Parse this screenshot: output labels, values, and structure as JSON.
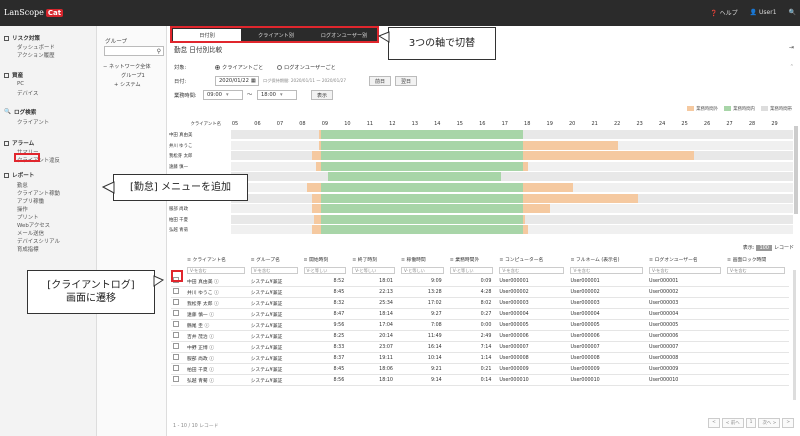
{
  "app": {
    "logo_text": "LanScope",
    "logo_badge": "Cat"
  },
  "top_tabs": [
    {
      "label": "日付別"
    },
    {
      "label": "クライアント別"
    },
    {
      "label": "ログオンユーザー別"
    }
  ],
  "top_right": {
    "help": "ヘルプ",
    "user": "User1"
  },
  "nav": {
    "sections": [
      {
        "title": "リスク対策",
        "items": [
          "ダッシュボード",
          "アクション履歴"
        ]
      },
      {
        "title": "資産",
        "items": [
          "PC",
          "デバイス"
        ]
      },
      {
        "title": "ログ検索",
        "items": [
          "クライアント"
        ]
      },
      {
        "title": "アラーム",
        "items": [
          "サマリー",
          "クライアント違反"
        ]
      },
      {
        "title": "レポート",
        "items": [
          "勤怠",
          "クライアント稼動",
          "アプリ稼働",
          "操作",
          "プリント",
          "Webアクセス",
          "メール送信",
          "デバイスシリアル",
          "育成指標"
        ]
      }
    ]
  },
  "group_panel": {
    "title": "グループ",
    "tree": [
      "ネットワーク全体",
      "グループ1",
      "システム"
    ]
  },
  "page": {
    "title": "勤怠 日付別比較"
  },
  "filters": {
    "target_label": "対象:",
    "radio_client": "クライアントごと",
    "radio_user": "ログオンユーザーごと",
    "date_label": "日付:",
    "date_value": "2020/01/22",
    "date_note": "ログ保持期間: 2020/01/11 ～ 2020/01/27",
    "prev_button": "前日",
    "next_button": "翌日",
    "hours_label": "業務時間:",
    "hours_from": "09:00",
    "hours_to": "18:00",
    "tilde": "～",
    "show_button": "表示"
  },
  "legend": [
    {
      "label": "業務時間外",
      "color": "#f5c9a0"
    },
    {
      "label": "業務時間内",
      "color": "#a8d5a8"
    },
    {
      "label": "業務時間帯",
      "color": "#dddddd"
    }
  ],
  "chart_data": {
    "type": "timeline",
    "row_header": "クライアント名",
    "hours": [
      "05",
      "06",
      "07",
      "08",
      "09",
      "10",
      "11",
      "12",
      "13",
      "14",
      "15",
      "16",
      "17",
      "18",
      "19",
      "20",
      "21",
      "22",
      "23",
      "24",
      "25",
      "26",
      "27",
      "28",
      "29"
    ],
    "business_hours": [
      9,
      18
    ],
    "rows": [
      {
        "name": "中田 真由美",
        "start": 8.9,
        "end": 18.0
      },
      {
        "name": "井川 ゆうこ",
        "start": 8.9,
        "end": 22.2
      },
      {
        "name": "我松芽 太郎",
        "start": 8.6,
        "end": 25.6
      },
      {
        "name": "遠藤 慎一",
        "start": 8.8,
        "end": 18.2
      },
      {
        "name": "",
        "start": 9.3,
        "end": 17.0
      },
      {
        "name": "",
        "start": 8.4,
        "end": 20.2
      },
      {
        "name": "",
        "start": 8.6,
        "end": 23.1
      },
      {
        "name": "服部 尚政",
        "start": 8.6,
        "end": 19.2
      },
      {
        "name": "柏田 千夏",
        "start": 8.7,
        "end": 18.1
      },
      {
        "name": "弘越 青菊",
        "start": 8.6,
        "end": 18.2
      }
    ]
  },
  "table": {
    "display_count_label": "表示:",
    "display_count": "100",
    "display_count_suffix": "レコード",
    "columns": [
      "クライアント名",
      "グループ名",
      "開始時刻",
      "終了時刻",
      "稼働時間",
      "業務時間外",
      "コンピューター名",
      "フルネーム (表示名)",
      "ログオンユーザー名",
      "画面ロック時間"
    ],
    "filter_contains": "V-を含む",
    "filter_equals": "V-と等しい",
    "rows": [
      {
        "client": "中田 真由美 ⓘ",
        "group": "システム¥兼証",
        "start": "8:52",
        "end": "18:01",
        "work": "9:09",
        "over": "0:09",
        "computer": "User000001",
        "fullname": "User000001",
        "logon": "User000001"
      },
      {
        "client": "井川 ゆうこ ⓘ",
        "group": "システム¥兼証",
        "start": "8:45",
        "end": "22:13",
        "work": "13:28",
        "over": "4:28",
        "computer": "User000002",
        "fullname": "User000002",
        "logon": "User000002"
      },
      {
        "client": "我松芽 太郎 ⓘ",
        "group": "システム¥兼証",
        "start": "8:32",
        "end": "25:34",
        "work": "17:02",
        "over": "8:02",
        "computer": "User000003",
        "fullname": "User000003",
        "logon": "User000003"
      },
      {
        "client": "遠藤 慎一 ⓘ",
        "group": "システム¥兼証",
        "start": "8:47",
        "end": "18:14",
        "work": "9:27",
        "over": "0:27",
        "computer": "User000004",
        "fullname": "User000004",
        "logon": "User000004"
      },
      {
        "client": "鶴尾 圭 ⓘ",
        "group": "システム¥兼証",
        "start": "9:56",
        "end": "17:04",
        "work": "7:08",
        "over": "0:00",
        "computer": "User000005",
        "fullname": "User000005",
        "logon": "User000005"
      },
      {
        "client": "吉井 茂治 ⓘ",
        "group": "システム¥兼証",
        "start": "8:25",
        "end": "20:14",
        "work": "11:49",
        "over": "2:49",
        "computer": "User000006",
        "fullname": "User000006",
        "logon": "User000006"
      },
      {
        "client": "中野 正博 ⓘ",
        "group": "システム¥兼証",
        "start": "8:33",
        "end": "23:07",
        "work": "16:14",
        "over": "7:14",
        "computer": "User000007",
        "fullname": "User000007",
        "logon": "User000007"
      },
      {
        "client": "服部 尚政 ⓘ",
        "group": "システム¥兼証",
        "start": "8:37",
        "end": "19:11",
        "work": "10:14",
        "over": "1:14",
        "computer": "User000008",
        "fullname": "User000008",
        "logon": "User000008"
      },
      {
        "client": "柏田 千夏 ⓘ",
        "group": "システム¥兼証",
        "start": "8:45",
        "end": "18:06",
        "work": "9:21",
        "over": "0:21",
        "computer": "User000009",
        "fullname": "User000009",
        "logon": "User000009"
      },
      {
        "client": "弘越 青菊 ⓘ",
        "group": "システム¥兼証",
        "start": "8:56",
        "end": "18:10",
        "work": "9:14",
        "over": "0:14",
        "computer": "User000010",
        "fullname": "User000010",
        "logon": "User000010"
      }
    ],
    "footer": "1 - 10 / 10 レコード",
    "pager": [
      "<",
      "< 前へ",
      "1",
      "次へ >",
      ">"
    ]
  },
  "callouts": {
    "tabs": "3つの軸で切替",
    "menu": "[勤怠] メニューを追加",
    "client_log": "[クライアントログ]\n画面に遷移"
  }
}
